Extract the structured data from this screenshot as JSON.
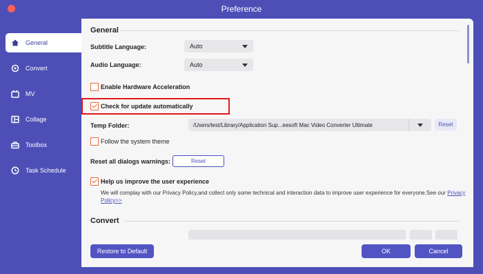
{
  "window": {
    "title": "Preference"
  },
  "sidebar": {
    "items": [
      {
        "label": "General",
        "icon": "home-icon",
        "active": true
      },
      {
        "label": "Convert",
        "icon": "convert-icon",
        "active": false
      },
      {
        "label": "MV",
        "icon": "mv-icon",
        "active": false
      },
      {
        "label": "Collage",
        "icon": "collage-icon",
        "active": false
      },
      {
        "label": "Toolbox",
        "icon": "toolbox-icon",
        "active": false
      },
      {
        "label": "Task Schedule",
        "icon": "clock-icon",
        "active": false
      }
    ]
  },
  "general": {
    "heading": "General",
    "subtitle_language": {
      "label": "Subtitle Language:",
      "value": "Auto"
    },
    "audio_language": {
      "label": "Audio Language:",
      "value": "Auto"
    },
    "hardware_acceleration": {
      "label": "Enable Hardware Acceleration",
      "checked": false
    },
    "check_update": {
      "label": "Check for update automatically",
      "checked": true
    },
    "temp_folder": {
      "label": "Temp Folder:",
      "value": "/Users/test/Library/Application Sup...eesoft Mac Video Converter Ultimate",
      "reset_label": "Reset"
    },
    "follow_theme": {
      "label": "Follow the system theme",
      "checked": false
    },
    "reset_dialogs": {
      "label": "Reset all dialogs warnings:",
      "button_label": "Reset"
    },
    "improve": {
      "label": "Help us improve the user experience",
      "checked": true,
      "description": "We will complay with our Privacy Policy,and collect only some technical and interaction data to improve user experience for everyone.See our",
      "link_label": "Privacy Policy>>"
    }
  },
  "convert": {
    "heading": "Convert"
  },
  "footer": {
    "restore_label": "Restore to Default",
    "ok_label": "OK",
    "cancel_label": "Cancel"
  },
  "colors": {
    "accent": "#4d4fb7",
    "checkbox": "#e86a3a",
    "highlight": "#e01818"
  }
}
